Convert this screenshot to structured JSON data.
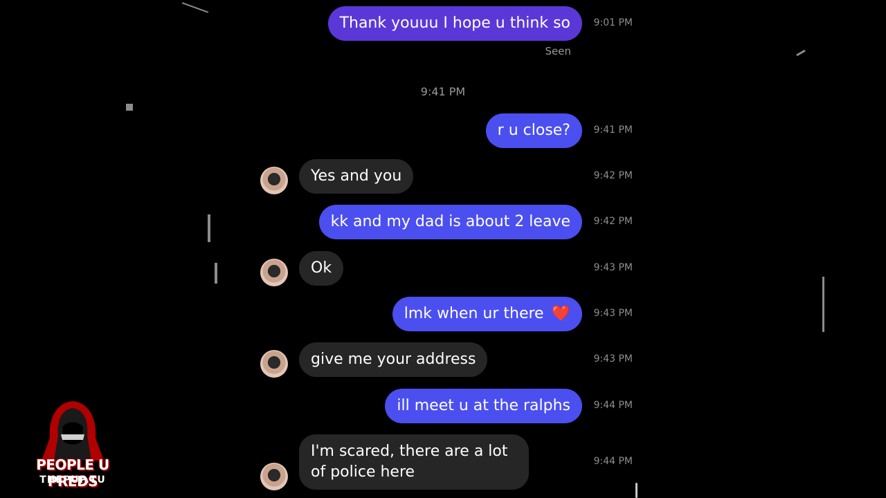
{
  "messages": [
    {
      "dir": "out",
      "text": "Thank youuu I hope u think so",
      "time": "9:01 PM"
    },
    {
      "dir": "out",
      "text": "r u close?",
      "time": "9:41 PM"
    },
    {
      "dir": "in",
      "text": "Yes and you",
      "time": "9:42 PM"
    },
    {
      "dir": "out",
      "text": "kk and my dad is about 2 leave",
      "time": "9:42 PM"
    },
    {
      "dir": "in",
      "text": "Ok",
      "time": "9:43 PM"
    },
    {
      "dir": "out",
      "text": "lmk when ur there",
      "emoji": "❤️",
      "time": "9:43 PM"
    },
    {
      "dir": "in",
      "text": "give me your address",
      "time": "9:43 PM"
    },
    {
      "dir": "out",
      "text": "ill meet u at the ralphs",
      "time": "9:44 PM"
    },
    {
      "dir": "in",
      "text": "I'm scared, there are a lot of police here",
      "time": "9:44 PM"
    }
  ],
  "seen_label": "Seen",
  "divider_time": "9:41 PM",
  "logo": {
    "title": "PEOPLE U PREDS",
    "subtitle": "THEPUP.TU"
  },
  "colors": {
    "outgoing": "#4b4ff0",
    "outgoing_top": "#5b37d8",
    "incoming": "#262626",
    "brand_red": "#c40000"
  }
}
